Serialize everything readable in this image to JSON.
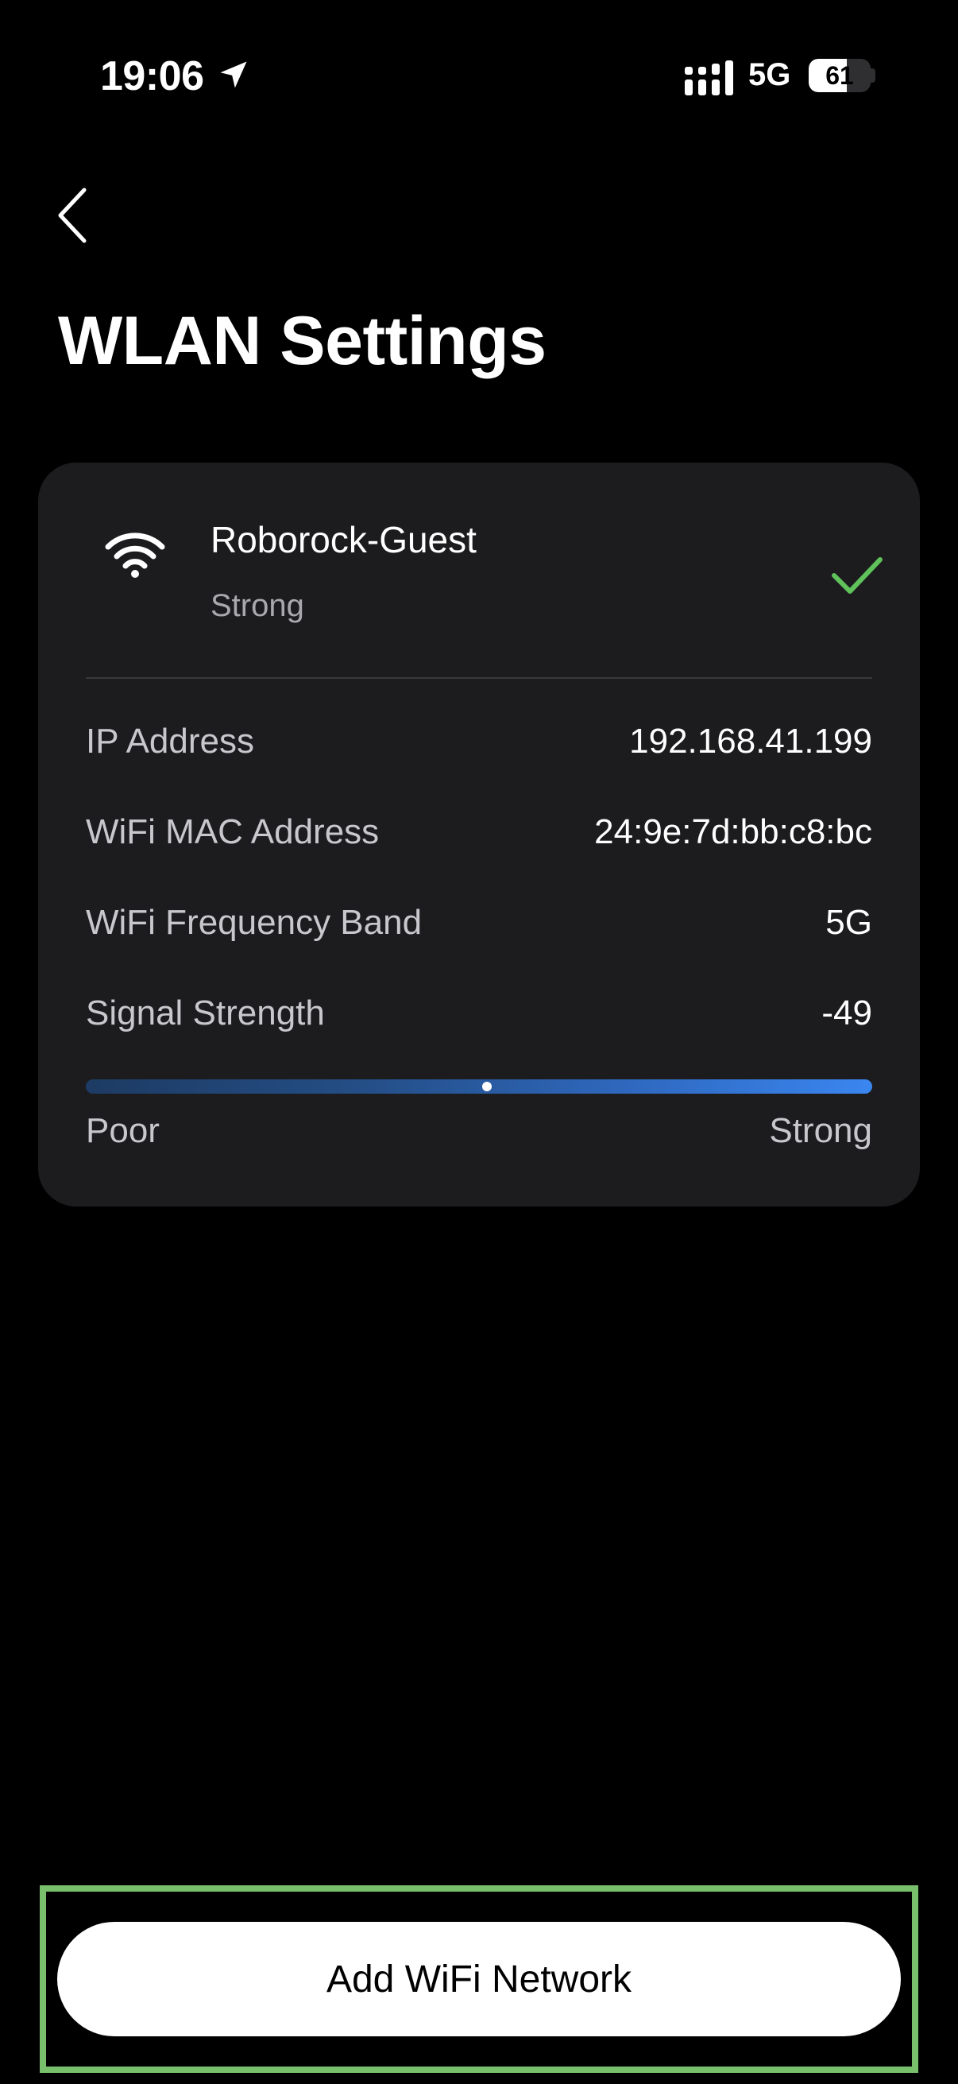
{
  "status_bar": {
    "time": "19:06",
    "network": "5G",
    "battery": "61",
    "battery_level": 0.61
  },
  "header": {
    "title": "WLAN Settings"
  },
  "network": {
    "name": "Roborock-Guest",
    "status": "Strong",
    "connected_color": "#5fc25b"
  },
  "details": [
    {
      "label": "IP Address",
      "value": "192.168.41.199"
    },
    {
      "label": "WiFi MAC Address",
      "value": "24:9e:7d:bb:c8:bc"
    },
    {
      "label": "WiFi Frequency Band",
      "value": "5G"
    },
    {
      "label": "Signal Strength",
      "value": "-49"
    }
  ],
  "signal_meter": {
    "min_label": "Poor",
    "max_label": "Strong",
    "level": 0.51
  },
  "actions": {
    "add_network_label": "Add WiFi Network"
  },
  "icons": {
    "back": "chevron-left-icon",
    "wifi": "wifi-icon",
    "check": "checkmark-icon",
    "location": "location-arrow-icon",
    "signal": "cellular-signal-icon",
    "battery": "battery-icon"
  },
  "colors": {
    "background": "#000000",
    "card": "#1c1c1e",
    "highlight_border": "#79c06d",
    "meter_end": "#3a86f0"
  }
}
